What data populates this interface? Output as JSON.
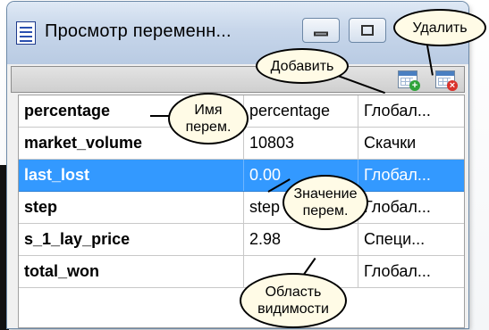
{
  "window": {
    "title": "Просмотр переменн..."
  },
  "toolbar": {
    "add_tooltip": "Добавить",
    "delete_tooltip": "Удалить"
  },
  "rows": [
    {
      "name": "percentage",
      "value": "percentage",
      "scope": "Глобал...",
      "selected": false
    },
    {
      "name": "market_volume",
      "value": "10803",
      "scope": "Скачки",
      "selected": false
    },
    {
      "name": "last_lost",
      "value": "0.00",
      "scope": "Глобал...",
      "selected": true
    },
    {
      "name": "step",
      "value": "step",
      "scope": "Глобал...",
      "selected": false
    },
    {
      "name": "s_1_lay_price",
      "value": "2.98",
      "scope": "Специ...",
      "selected": false
    },
    {
      "name": "total_won",
      "value": "",
      "scope": "Глобал...",
      "selected": false
    }
  ],
  "annotations": {
    "name": "Имя\nперем.",
    "value": "Значение\nперем.",
    "scope": "Область\nвидимости",
    "add": "Добавить",
    "delete": "Удалить"
  },
  "colors": {
    "selection": "#3399ff",
    "bubble_fill": "#fffbe6"
  }
}
